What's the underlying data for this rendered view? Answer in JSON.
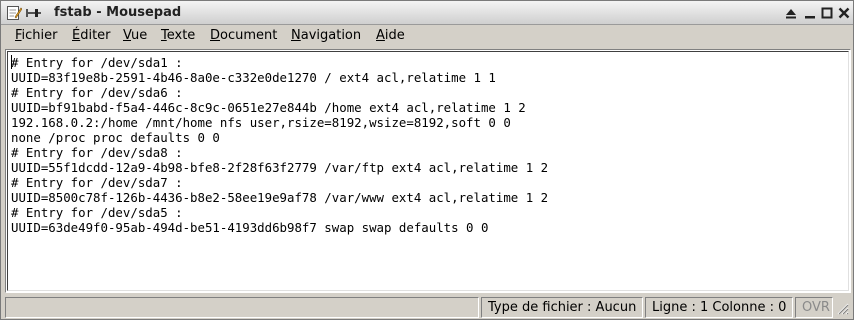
{
  "window": {
    "title": "fstab - Mousepad"
  },
  "titlebar_icons": [
    "document-edit-icon",
    "pin-icon"
  ],
  "window_controls": [
    "shade-icon",
    "minimize-icon",
    "maximize-icon",
    "close-icon"
  ],
  "menubar": {
    "items": [
      {
        "mnemonic": "F",
        "rest": "ichier"
      },
      {
        "mnemonic": "É",
        "rest": "diter"
      },
      {
        "mnemonic": "V",
        "rest": "ue"
      },
      {
        "mnemonic": "T",
        "rest": "exte"
      },
      {
        "mnemonic": "D",
        "rest": "ocument"
      },
      {
        "mnemonic": "N",
        "rest": "avigation"
      },
      {
        "mnemonic": "A",
        "rest": "ide"
      }
    ]
  },
  "editor": {
    "lines": [
      "# Entry for /dev/sda1 :",
      "UUID=83f19e8b-2591-4b46-8a0e-c332e0de1270 / ext4 acl,relatime 1 1",
      "# Entry for /dev/sda6 :",
      "UUID=bf91babd-f5a4-446c-8c9c-0651e27e844b /home ext4 acl,relatime 1 2",
      "192.168.0.2:/home /mnt/home nfs user,rsize=8192,wsize=8192,soft 0 0",
      "none /proc proc defaults 0 0",
      "# Entry for /dev/sda8 :",
      "UUID=55f1dcdd-12a9-4b98-bfe8-2f28f63f2779 /var/ftp ext4 acl,relatime 1 2",
      "# Entry for /dev/sda7 :",
      "UUID=8500c78f-126b-4436-b8e2-58ee19e9af78 /var/www ext4 acl,relatime 1 2",
      "# Entry for /dev/sda5 :",
      "UUID=63de49f0-95ab-494d-be51-4193dd6b98f7 swap swap defaults 0 0"
    ]
  },
  "statusbar": {
    "message": "",
    "file_type": "Type de fichier : Aucun",
    "position": "Ligne : 1 Colonne : 0",
    "overwrite": "OVR"
  },
  "colors": {
    "background": "#d4d0c8",
    "editor_bg": "#ffffff",
    "ovr_disabled": "#8a8a8a"
  }
}
